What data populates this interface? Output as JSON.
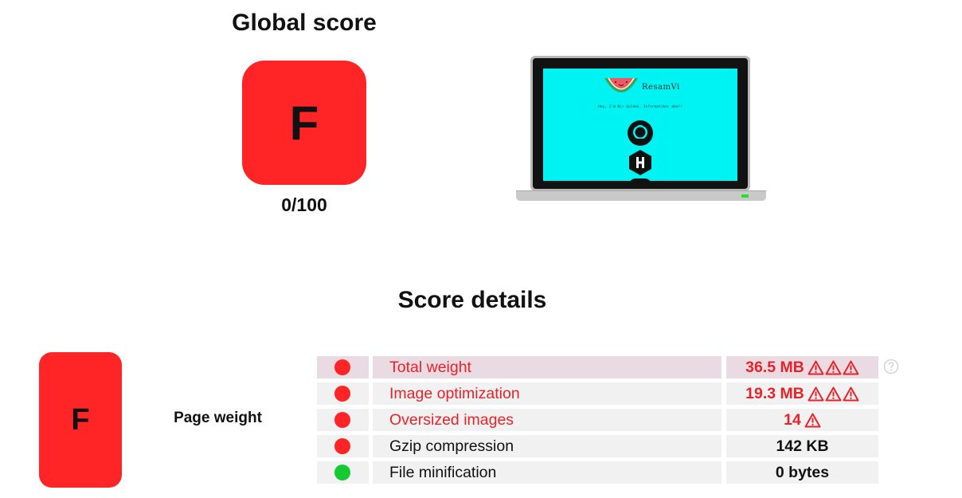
{
  "header": {
    "global_title": "Global score",
    "grade": "F",
    "score": "0/100"
  },
  "preview": {
    "site_name": "ResamVi",
    "tagline": "Hey, I'm Nir Golden. Informatiker aber!"
  },
  "details": {
    "title": "Score details",
    "category": {
      "grade": "F",
      "label": "Page weight"
    },
    "rows": [
      {
        "label": "Total weight",
        "value": "36.5 MB",
        "status": "bad",
        "warnings": 3,
        "highlight": true
      },
      {
        "label": "Image optimization",
        "value": "19.3 MB",
        "status": "bad",
        "warnings": 3
      },
      {
        "label": "Oversized images",
        "value": "14",
        "status": "bad",
        "warnings": 1
      },
      {
        "label": "Gzip compression",
        "value": "142 KB",
        "status": "bad",
        "warnings": 0
      },
      {
        "label": "File minification",
        "value": "0 bytes",
        "status": "good",
        "warnings": 0
      }
    ]
  },
  "colors": {
    "grade_red": "#ff2426",
    "bad_text": "#e7232a",
    "good_dot": "#14c932",
    "highlight_row": "#e9dbe1"
  },
  "icons": {
    "warning": "warning-triangle-icon",
    "help": "help-circle-icon"
  }
}
